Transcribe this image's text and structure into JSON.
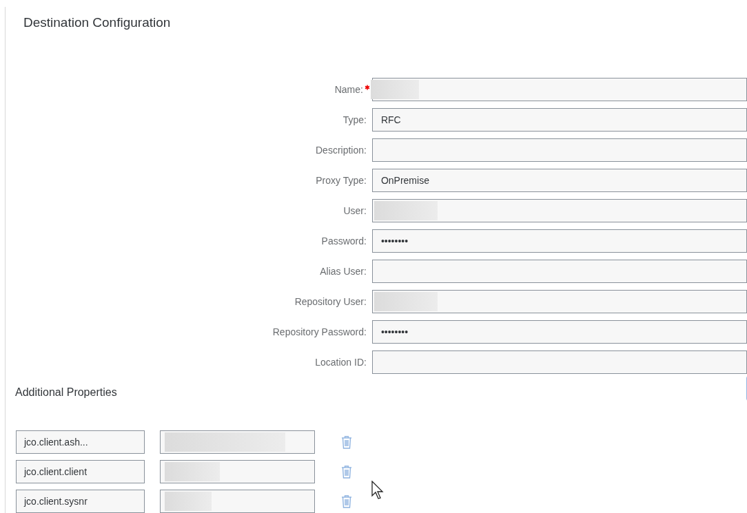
{
  "title": "Destination Configuration",
  "fields": [
    {
      "label": "Name:",
      "required": true,
      "redacted": true
    },
    {
      "label": "Type:",
      "required": false,
      "value": "RFC",
      "redacted": false
    },
    {
      "label": "Description:",
      "required": false,
      "redacted": false
    },
    {
      "label": "Proxy Type:",
      "required": false,
      "value": "OnPremise",
      "redacted": false
    },
    {
      "label": "User:",
      "required": false,
      "redacted": true
    },
    {
      "label": "Password:",
      "required": false,
      "value": "••••••••",
      "redacted": false
    },
    {
      "label": "Alias User:",
      "required": false,
      "redacted": false
    },
    {
      "label": "Repository User:",
      "required": false,
      "redacted": true
    },
    {
      "label": "Repository Password:",
      "required": false,
      "value": "••••••••",
      "redacted": false
    },
    {
      "label": "Location ID:",
      "required": false,
      "redacted": false
    }
  ],
  "additional_properties": {
    "title": "Additional Properties",
    "rows": [
      {
        "key": "jco.client.ash...",
        "redacted": true
      },
      {
        "key": "jco.client.client",
        "redacted": true
      },
      {
        "key": "jco.client.sysnr",
        "redacted": true
      }
    ]
  }
}
